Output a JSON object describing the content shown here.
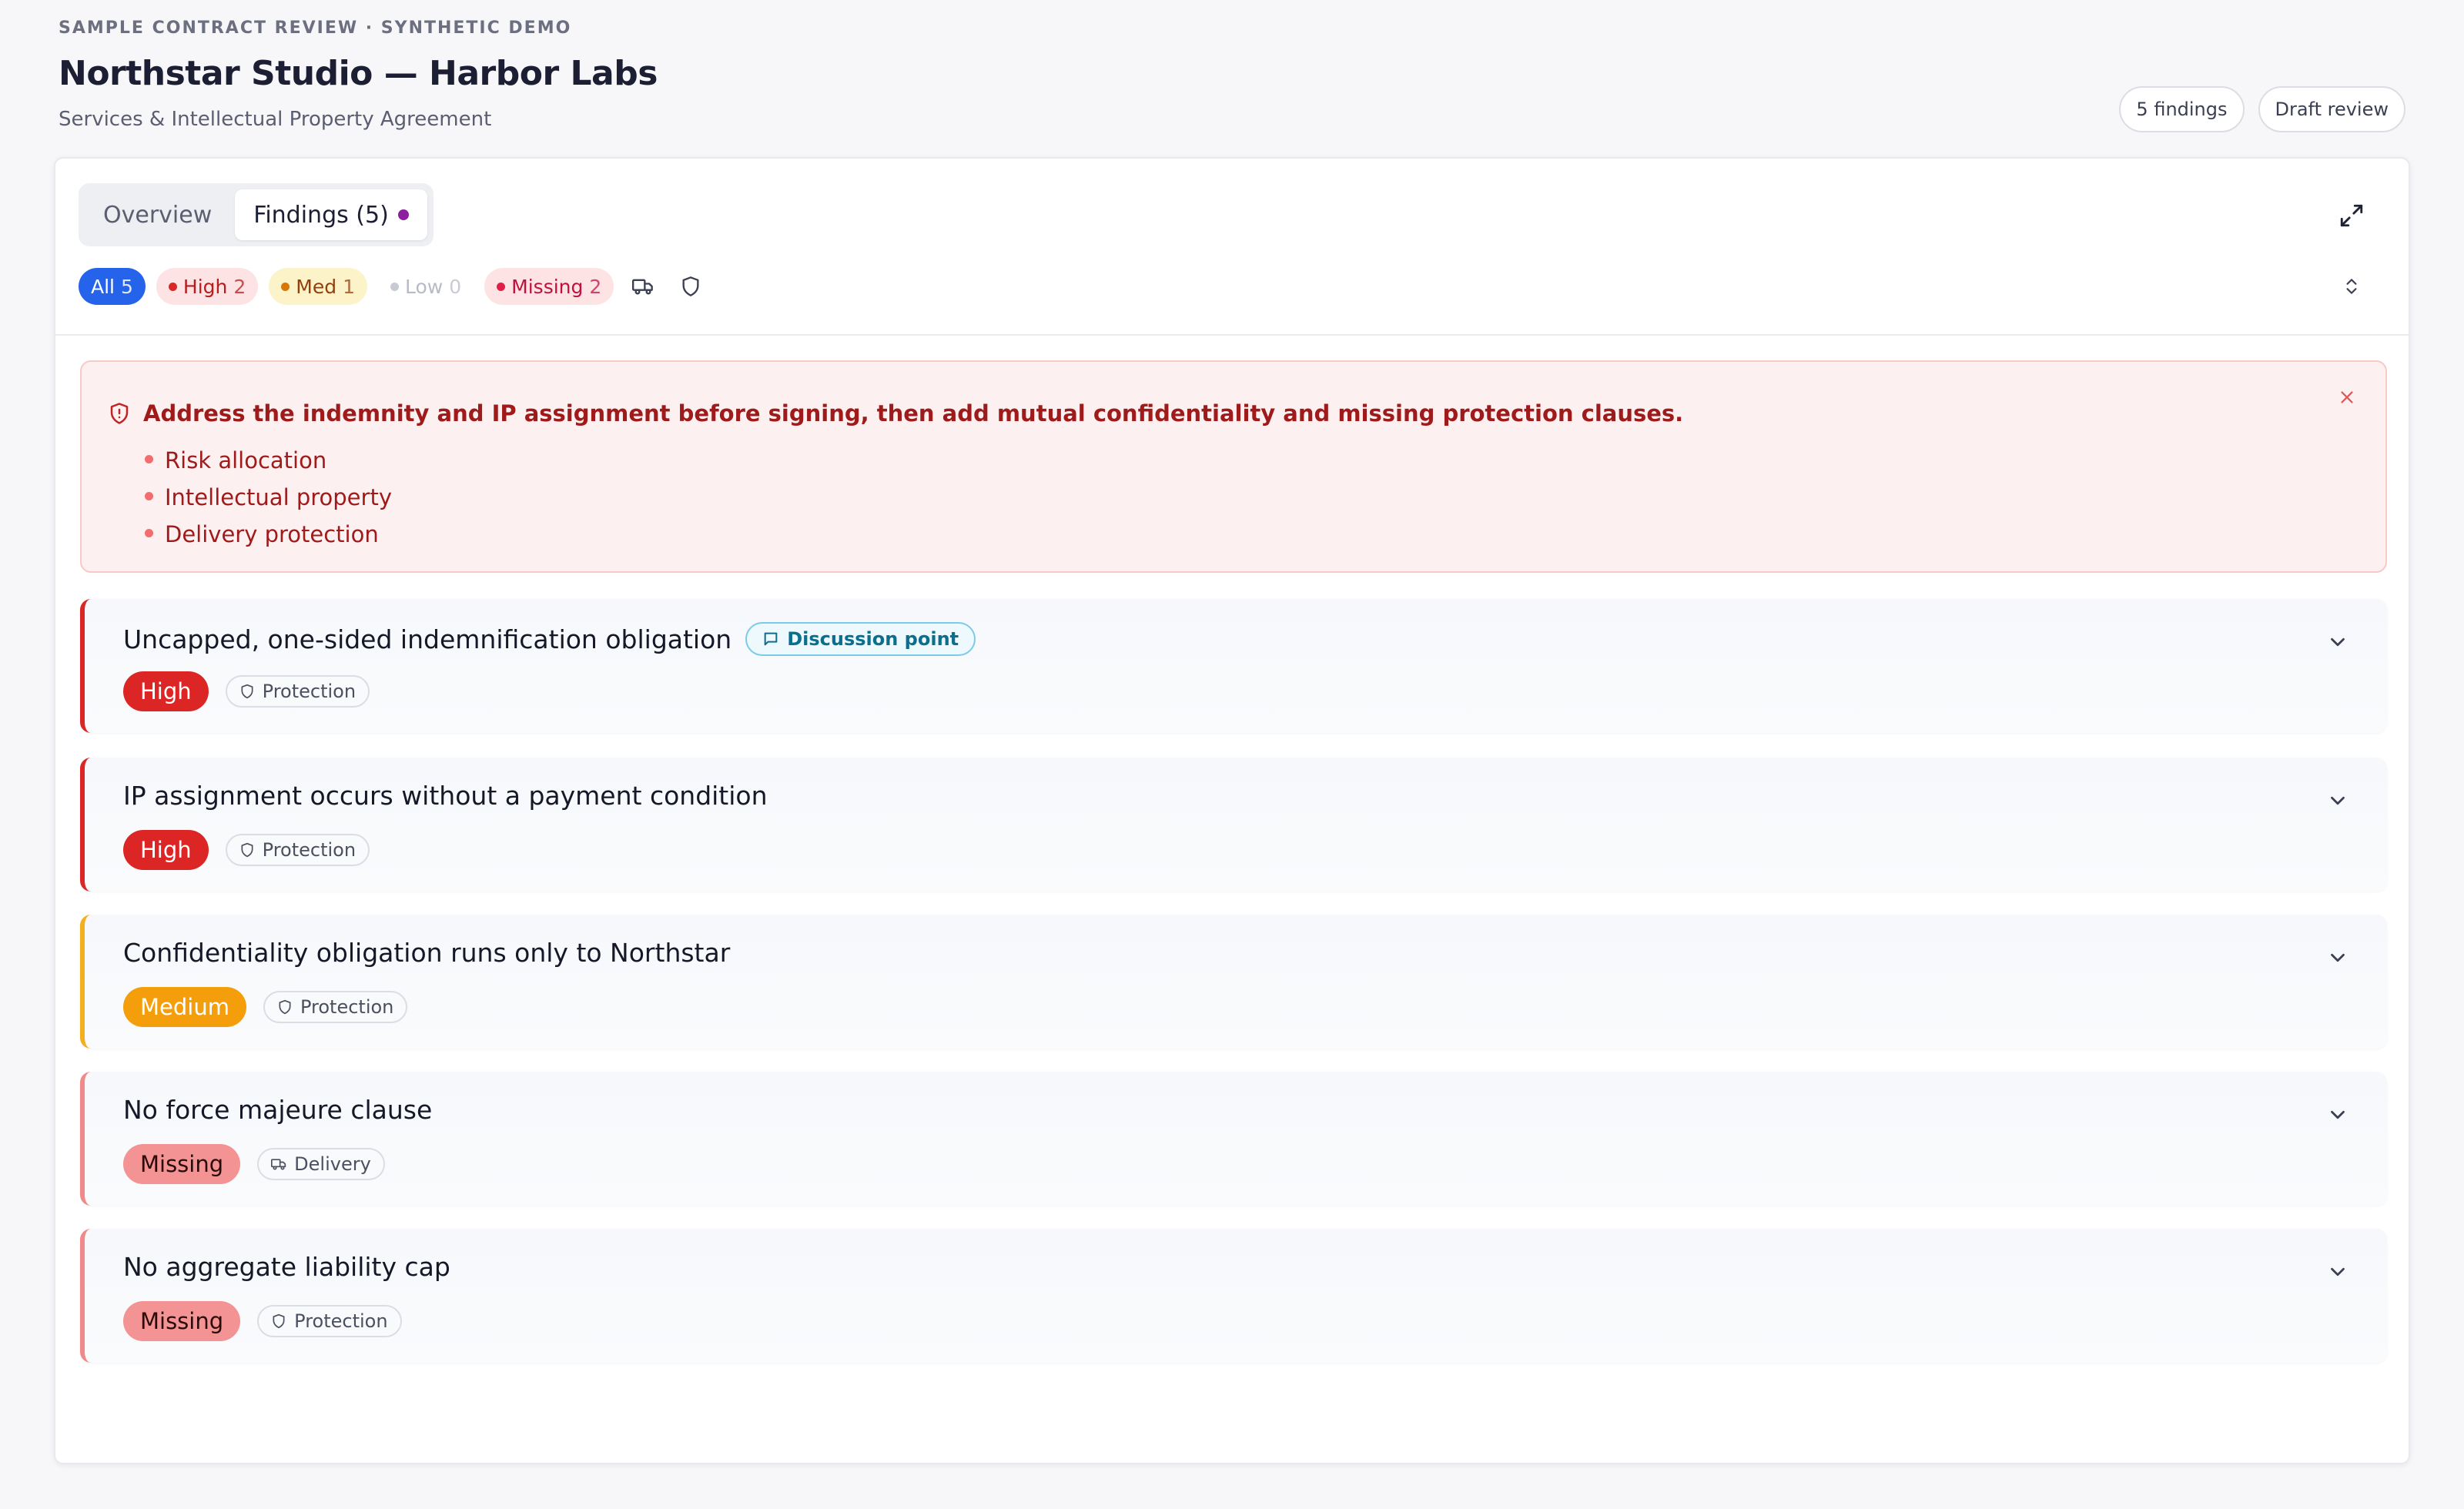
{
  "header": {
    "eyebrow": "SAMPLE CONTRACT REVIEW · SYNTHETIC DEMO",
    "title": "Northstar Studio — Harbor Labs",
    "subtitle": "Services & Intellectual Property Agreement",
    "pills": [
      "5 findings",
      "Draft review"
    ]
  },
  "tabs": [
    {
      "label": "Overview",
      "active": false
    },
    {
      "label": "Findings (5)",
      "active": true
    }
  ],
  "filters": {
    "all": {
      "label": "All",
      "count": "5"
    },
    "high": {
      "label": "High",
      "count": "2"
    },
    "med": {
      "label": "Med",
      "count": "1"
    },
    "low": {
      "label": "Low",
      "count": "0"
    },
    "missing": {
      "label": "Missing",
      "count": "2"
    }
  },
  "alert": {
    "title": "Address the indemnity and IP assignment before signing, then add mutual confidentiality and missing protection clauses.",
    "items": [
      "Risk allocation",
      "Intellectual property",
      "Delivery protection"
    ]
  },
  "findings": [
    {
      "title": "Uncapped, one-sided indemnification obligation",
      "severity": "High",
      "category": "Protection",
      "tag": "Discussion point"
    },
    {
      "title": "IP assignment occurs without a payment condition",
      "severity": "High",
      "category": "Protection"
    },
    {
      "title": "Confidentiality obligation runs only to Northstar",
      "severity": "Medium",
      "category": "Protection"
    },
    {
      "title": "No force majeure clause",
      "severity": "Missing",
      "category": "Delivery"
    },
    {
      "title": "No aggregate liability cap",
      "severity": "Missing",
      "category": "Protection"
    }
  ],
  "colors": {
    "high": "#dc2626",
    "medium": "#f59e0b",
    "missing": "#f49393",
    "accent": "#2563eb"
  }
}
